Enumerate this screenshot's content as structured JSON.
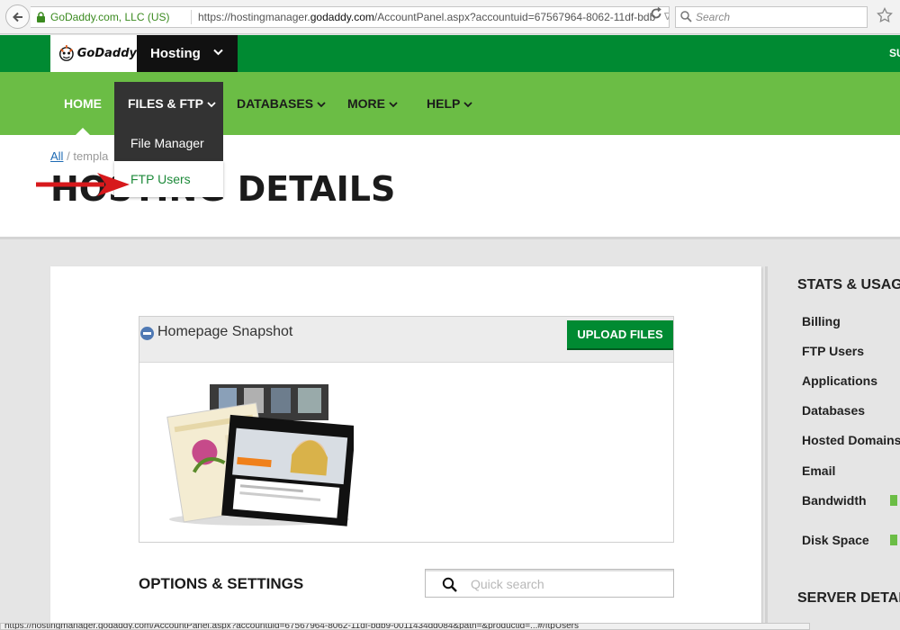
{
  "browser": {
    "site_identity": "GoDaddy.com, LLC (US)",
    "url_prefix": "https://hostingmanager.",
    "url_domain": "godaddy.com",
    "url_path": "/AccountPanel.aspx?accountuid=67567964-8062-11df-bdb",
    "url_dropdown": "∇",
    "search_placeholder": "Search"
  },
  "topbar": {
    "logo_text": "GoDaddy",
    "product_label": "Hosting",
    "right_text": "SU"
  },
  "nav": {
    "home": "HOME",
    "files": "FILES & FTP",
    "databases": "DATABASES",
    "more": "MORE",
    "help": "HELP"
  },
  "dropdown": {
    "item_file_manager": "File Manager",
    "item_ftp_users": "FTP Users"
  },
  "header": {
    "breadcrumb_all": "All",
    "breadcrumb_sep": "/",
    "breadcrumb_current": "templa",
    "page_title": "HOSTING DETAILS"
  },
  "snapshot": {
    "title": "Homepage Snapshot",
    "upload_button": "UPLOAD FILES"
  },
  "options": {
    "title": "OPTIONS & SETTINGS",
    "search_placeholder": "Quick search"
  },
  "sidebar": {
    "stats_title": "STATS & USAGE",
    "items": [
      "Billing",
      "FTP Users",
      "Applications",
      "Databases",
      "Hosted Domains",
      "Email",
      "Bandwidth",
      "Disk Space"
    ],
    "server_title": "SERVER DETAILS"
  },
  "status_bar": {
    "text": "https://hostingmanager.godaddy.com/AccountPanel.aspx?accountuid=67567964-8062-11df-bdb9-0011434dd084&path=&productid=...#/ftpUsers"
  },
  "colors": {
    "brand_dark_green": "#008a32",
    "nav_green": "#6bbd45",
    "dropdown_bg": "#333333",
    "link_green": "#1d8a3a",
    "arrow_red": "#d7191c"
  }
}
